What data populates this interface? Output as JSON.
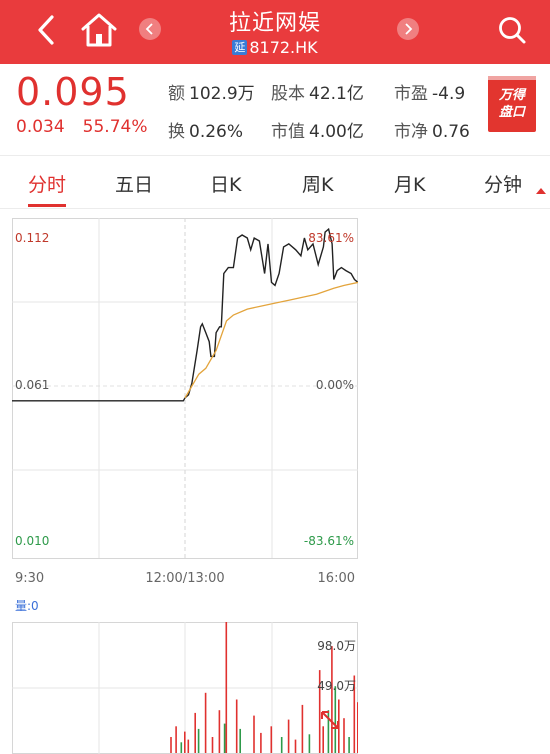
{
  "header": {
    "title": "拉近网娱",
    "badge": "延",
    "code": "8172.HK",
    "bg_color": "#e93b3d"
  },
  "icons": [
    "back-arrow-icon",
    "home-icon",
    "prev-stock-icon",
    "next-stock-icon",
    "search-icon"
  ],
  "quote": {
    "price": "0.095",
    "change": "0.034",
    "change_pct": "55.74%",
    "up_color": "#e0312f"
  },
  "stats": {
    "amount_label": "额",
    "amount": "102.9万",
    "shares_label": "股本",
    "shares": "42.1亿",
    "pe_label": "市盈",
    "pe": "-4.9",
    "turnover_label": "换",
    "turnover": "0.26%",
    "mktcap_label": "市值",
    "mktcap": "4.00亿",
    "pb_label": "市净",
    "pb": "0.76"
  },
  "wande": {
    "line1": "万得",
    "line2": "盘口"
  },
  "tabs": [
    {
      "label": "分时",
      "active": true
    },
    {
      "label": "五日"
    },
    {
      "label": "日K"
    },
    {
      "label": "周K"
    },
    {
      "label": "月K"
    },
    {
      "label": "分钟"
    }
  ],
  "chart_data": {
    "type": "line",
    "time_labels": [
      "9:30",
      "12:00/13:00",
      "16:00"
    ],
    "price_axis": {
      "top": "0.112",
      "mid": "0.061",
      "bottom": "0.010"
    },
    "pct_axis": {
      "top": "83.61%",
      "mid": "0.00%",
      "bottom": "-83.61%"
    },
    "ylim": [
      0.01,
      0.112
    ],
    "prev_close": 0.061,
    "series": [
      {
        "color": "#222222",
        "points": [
          [
            0,
            0.057
          ],
          [
            0.495,
            0.057
          ],
          [
            0.5,
            0.058
          ],
          [
            0.51,
            0.059
          ],
          [
            0.52,
            0.063
          ],
          [
            0.535,
            0.074
          ],
          [
            0.545,
            0.082
          ],
          [
            0.55,
            0.083
          ],
          [
            0.56,
            0.08
          ],
          [
            0.57,
            0.077
          ],
          [
            0.575,
            0.072
          ],
          [
            0.585,
            0.072
          ],
          [
            0.59,
            0.08
          ],
          [
            0.6,
            0.082
          ],
          [
            0.605,
            0.082
          ],
          [
            0.612,
            0.1
          ],
          [
            0.625,
            0.102
          ],
          [
            0.64,
            0.102
          ],
          [
            0.652,
            0.112
          ],
          [
            0.665,
            0.113
          ],
          [
            0.68,
            0.112
          ],
          [
            0.69,
            0.108
          ],
          [
            0.7,
            0.112
          ],
          [
            0.715,
            0.111
          ],
          [
            0.73,
            0.1
          ],
          [
            0.74,
            0.11
          ],
          [
            0.75,
            0.097
          ],
          [
            0.76,
            0.096
          ],
          [
            0.772,
            0.1
          ],
          [
            0.785,
            0.109
          ],
          [
            0.8,
            0.11
          ],
          [
            0.82,
            0.108
          ],
          [
            0.835,
            0.106
          ],
          [
            0.845,
            0.112
          ],
          [
            0.855,
            0.108
          ],
          [
            0.87,
            0.11
          ],
          [
            0.885,
            0.103
          ],
          [
            0.9,
            0.109
          ],
          [
            0.905,
            0.114
          ],
          [
            0.915,
            0.115
          ],
          [
            0.925,
            0.11
          ],
          [
            0.93,
            0.098
          ],
          [
            0.94,
            0.101
          ],
          [
            0.952,
            0.102
          ],
          [
            0.965,
            0.101
          ],
          [
            0.98,
            0.1
          ],
          [
            0.99,
            0.098
          ],
          [
            1.0,
            0.097
          ]
        ]
      },
      {
        "color": "#e3a43c",
        "points": [
          [
            0.5,
            0.058
          ],
          [
            0.51,
            0.06
          ],
          [
            0.52,
            0.062
          ],
          [
            0.54,
            0.066
          ],
          [
            0.56,
            0.068
          ],
          [
            0.59,
            0.074
          ],
          [
            0.62,
            0.084
          ],
          [
            0.64,
            0.086
          ],
          [
            0.68,
            0.088
          ],
          [
            0.72,
            0.089
          ],
          [
            0.76,
            0.09
          ],
          [
            0.8,
            0.091
          ],
          [
            0.84,
            0.092
          ],
          [
            0.88,
            0.093
          ],
          [
            0.93,
            0.095
          ],
          [
            0.96,
            0.096
          ],
          [
            1.0,
            0.097
          ]
        ]
      }
    ],
    "volume": {
      "label": "量:0",
      "scale_labels": [
        "98.0万",
        "49.0万"
      ],
      "ymax": 98.0,
      "bars": [
        [
          0.46,
          12,
          "r"
        ],
        [
          0.475,
          20,
          "r"
        ],
        [
          0.49,
          8,
          "g"
        ],
        [
          0.5,
          16,
          "r"
        ],
        [
          0.51,
          10,
          "r"
        ],
        [
          0.53,
          30,
          "r"
        ],
        [
          0.54,
          18,
          "g"
        ],
        [
          0.56,
          45,
          "r"
        ],
        [
          0.58,
          12,
          "r"
        ],
        [
          0.6,
          32,
          "r"
        ],
        [
          0.615,
          22,
          "g"
        ],
        [
          0.62,
          98,
          "r"
        ],
        [
          0.65,
          40,
          "r"
        ],
        [
          0.66,
          18,
          "g"
        ],
        [
          0.7,
          28,
          "r"
        ],
        [
          0.72,
          15,
          "r"
        ],
        [
          0.75,
          20,
          "r"
        ],
        [
          0.78,
          12,
          "g"
        ],
        [
          0.8,
          25,
          "r"
        ],
        [
          0.82,
          10,
          "r"
        ],
        [
          0.84,
          36,
          "r"
        ],
        [
          0.86,
          14,
          "g"
        ],
        [
          0.89,
          62,
          "r"
        ],
        [
          0.9,
          20,
          "r"
        ],
        [
          0.915,
          32,
          "g"
        ],
        [
          0.925,
          80,
          "r"
        ],
        [
          0.935,
          50,
          "g"
        ],
        [
          0.945,
          40,
          "r"
        ],
        [
          0.96,
          26,
          "r"
        ],
        [
          0.975,
          12,
          "g"
        ],
        [
          0.99,
          58,
          "r"
        ],
        [
          1.0,
          38,
          "r"
        ]
      ]
    }
  }
}
